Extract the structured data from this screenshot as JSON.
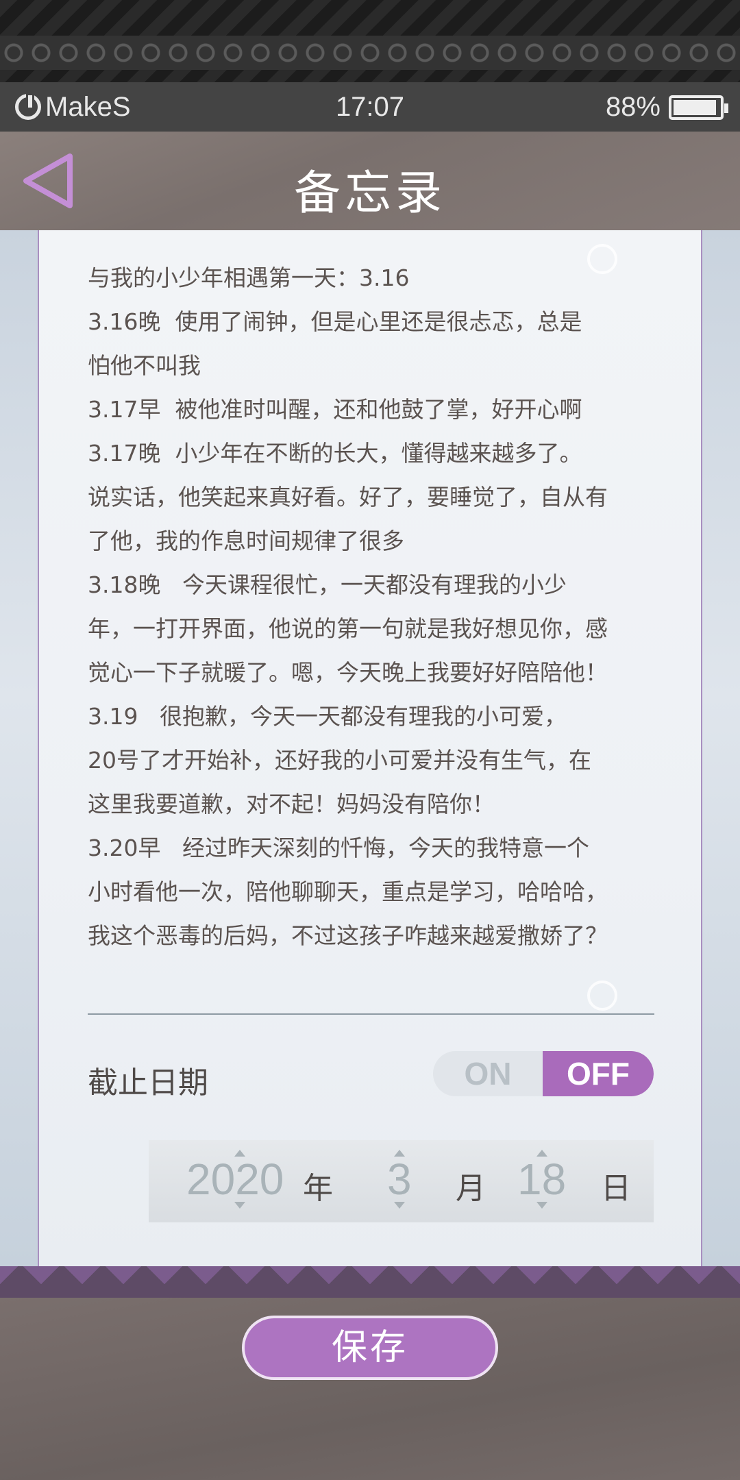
{
  "status_bar": {
    "brand": "MakeS",
    "time": "17:07",
    "battery": "88%"
  },
  "header": {
    "title": "备忘录",
    "back_icon": "back-triangle-icon"
  },
  "memo": {
    "lines": [
      "与我的小少年相遇第一天：3.16",
      "3.16晚  使用了闹钟，但是心里还是很忐忑，总是",
      "怕他不叫我",
      "3.17早  被他准时叫醒，还和他鼓了掌，好开心啊",
      "3.17晚  小少年在不断的长大，懂得越来越多了。",
      "说实话，他笑起来真好看。好了，要睡觉了，自从有",
      "了他，我的作息时间规律了很多",
      "3.18晚   今天课程很忙，一天都没有理我的小少",
      "年，一打开界面，他说的第一句就是我好想见你，感",
      "觉心一下子就暖了。嗯，今天晚上我要好好陪陪他！",
      "3.19   很抱歉，今天一天都没有理我的小可爱，",
      "20号了才开始补，还好我的小可爱并没有生气，在",
      "这里我要道歉，对不起！妈妈没有陪你！",
      "3.20早   经过昨天深刻的忏悔，今天的我特意一个",
      "小时看他一次，陪他聊聊天，重点是学习，哈哈哈，",
      "我这个恶毒的后妈，不过这孩子咋越来越爱撒娇了？"
    ]
  },
  "deadline": {
    "label": "截止日期",
    "toggle_on": "ON",
    "toggle_off": "OFF",
    "selected": "OFF"
  },
  "date": {
    "year": "2020",
    "year_unit": "年",
    "month": "3",
    "month_unit": "月",
    "day": "18",
    "day_unit": "日"
  },
  "save_label": "保存",
  "colors": {
    "accent": "#ad74c1",
    "header_bg": "#857a77",
    "text": "#5b5350"
  }
}
